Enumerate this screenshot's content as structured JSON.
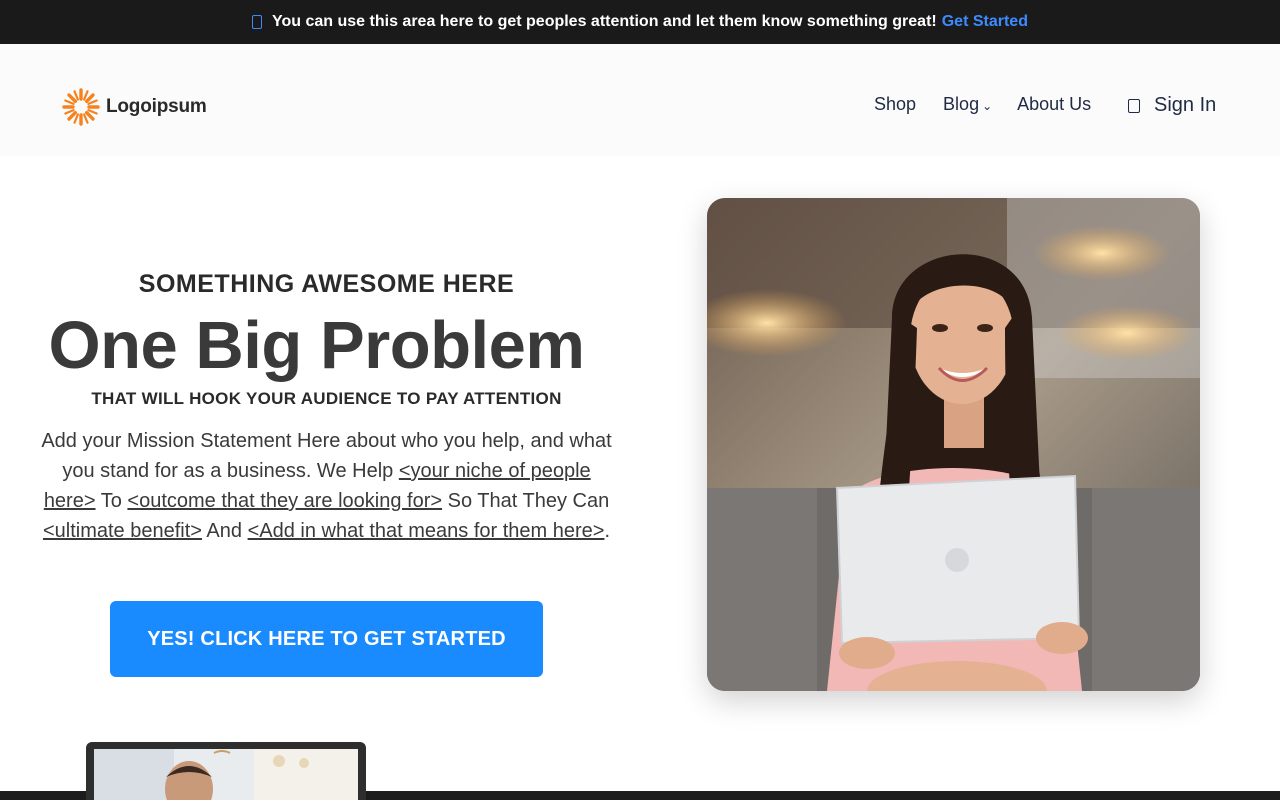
{
  "announcement": {
    "text": "You can use this area here to get peoples attention and let them know something great!",
    "link_label": "Get Started"
  },
  "header": {
    "logo_text": "Logoipsum",
    "nav": [
      {
        "label": "Shop"
      },
      {
        "label": "Blog",
        "has_dropdown": true
      },
      {
        "label": "About Us"
      }
    ],
    "signin_label": "Sign In"
  },
  "hero": {
    "eyebrow": "SOMETHING AWESOME HERE",
    "headline": "One Big Problem",
    "subhead": "THAT WILL HOOK YOUR AUDIENCE TO PAY ATTENTION",
    "mission": {
      "part1": "Add your Mission Statement Here about who you help, and what you stand for as a business. We Help ",
      "link1": "<your niche of people here>",
      "part2": " To ",
      "link2": "<outcome that they are looking for>",
      "part3": " So That They Can ",
      "link3": "<ultimate benefit>",
      "part4": " And ",
      "link4": "<Add in what that means for them here>",
      "part5": "."
    },
    "cta_label": "YES! CLICK HERE TO GET STARTED"
  },
  "icons": {
    "announcement": "bell-icon",
    "logo": "sun-burst-logo-icon",
    "signin": "user-icon",
    "blog_dropdown": "chevron-down-icon"
  },
  "colors": {
    "accent": "#1a8bff",
    "link": "#3d8bff",
    "logo_orange": "#f5821f",
    "topbar_bg": "#1a1a1a",
    "nav_text": "#1f2a44"
  }
}
